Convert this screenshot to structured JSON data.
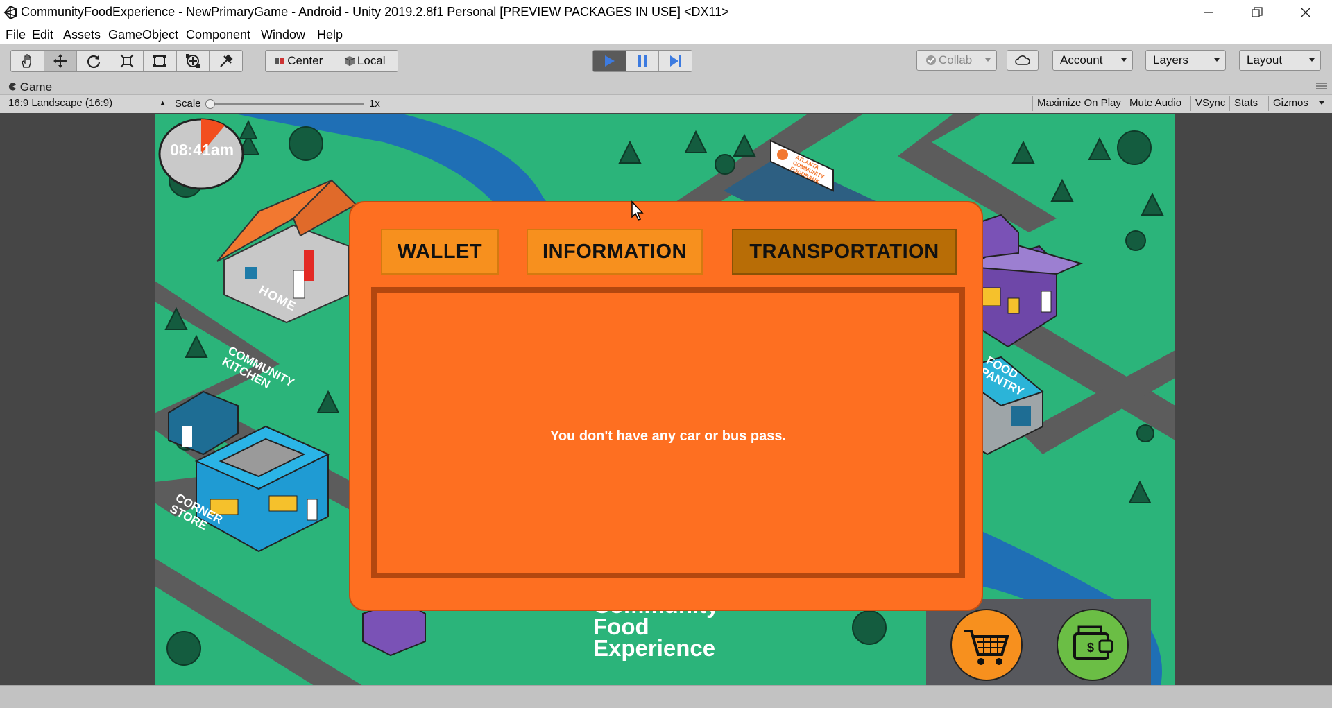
{
  "window": {
    "title": "CommunityFoodExperience - NewPrimaryGame - Android - Unity 2019.2.8f1 Personal [PREVIEW PACKAGES IN USE] <DX11>",
    "minimize_icon": "minimize-icon",
    "maximize_icon": "restore-icon",
    "close_icon": "close-icon"
  },
  "menu": {
    "items": [
      "File",
      "Edit",
      "Assets",
      "GameObject",
      "Component",
      "Window",
      "Help"
    ]
  },
  "toolbar": {
    "tools": [
      "hand-tool-icon",
      "move-tool-icon",
      "rotate-tool-icon",
      "scale-tool-icon",
      "rect-tool-icon",
      "transform-tool-icon",
      "custom-tool-icon"
    ],
    "pivot_label": "Center",
    "space_label": "Local",
    "play_icon": "play-icon",
    "pause_icon": "pause-icon",
    "step_icon": "step-icon",
    "collab_label": "Collab",
    "account_label": "Account",
    "layers_label": "Layers",
    "layout_label": "Layout",
    "accent_color": "#3d7be0"
  },
  "game_view": {
    "tab_label": "Game",
    "aspect_label": "16:9 Landscape (16:9)",
    "scale_label": "Scale",
    "scale_value": "1x",
    "buttons": [
      "Maximize On Play",
      "Mute Audio",
      "VSync",
      "Stats",
      "Gizmos"
    ]
  },
  "game": {
    "clock_time": "08:41am",
    "map_labels": {
      "home": "HOME",
      "community_kitchen": "COMMUNITY KITCHEN",
      "corner_store": "CORNER STORE",
      "food_pantry": "FOOD PANTRY",
      "billboard": "ATLANTA COMMUNITY FOODBANK"
    },
    "logo_lines": [
      "Community",
      "Food",
      "Experience"
    ],
    "dialog": {
      "tabs": [
        "WALLET",
        "INFORMATION",
        "TRANSPORTATION"
      ],
      "selected_tab": "TRANSPORTATION",
      "message": "You don't have any car or bus pass."
    },
    "buttons": {
      "cart_icon": "shopping-cart-icon",
      "wallet_icon": "wallet-icon"
    },
    "colors": {
      "grass": "#2bb47a",
      "road": "#5c5c5c",
      "river": "#1f6fb5",
      "dialog": "#fe6f21",
      "tab": "#f7901e",
      "tab_selected": "#b86d06"
    }
  }
}
